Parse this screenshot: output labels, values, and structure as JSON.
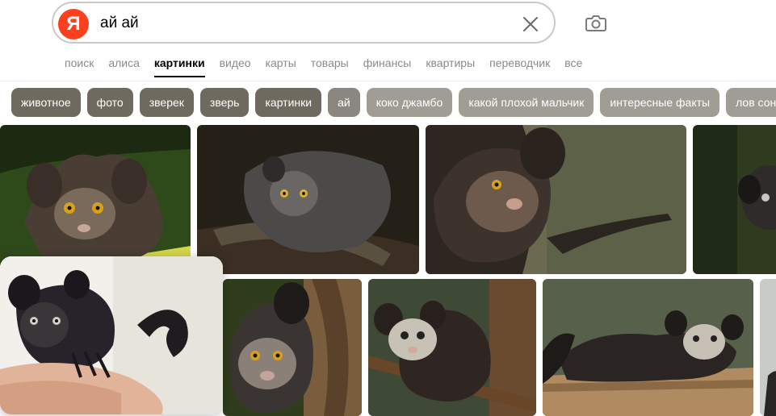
{
  "search": {
    "logo_letter": "Я",
    "query": "ай ай"
  },
  "nav": {
    "items": [
      {
        "label": "поиск"
      },
      {
        "label": "алиса"
      },
      {
        "label": "картинки",
        "active": true
      },
      {
        "label": "видео"
      },
      {
        "label": "карты"
      },
      {
        "label": "товары"
      },
      {
        "label": "финансы"
      },
      {
        "label": "квартиры"
      },
      {
        "label": "переводчик"
      },
      {
        "label": "все"
      }
    ]
  },
  "chips": [
    {
      "label": "животное"
    },
    {
      "label": "фото"
    },
    {
      "label": "зверек"
    },
    {
      "label": "зверь"
    },
    {
      "label": "картинки"
    },
    {
      "label": "ай"
    },
    {
      "label": "коко джамбо"
    },
    {
      "label": "какой плохой мальчик"
    },
    {
      "label": "интересные факты"
    },
    {
      "label": "лов сонг"
    }
  ],
  "colors": {
    "logo": "#fc3f1d",
    "chip_dark": "#6e6a60",
    "chip_light": "#a09d94",
    "nav_inactive": "#8a8a8a"
  },
  "icons": {
    "clear": "close-icon",
    "camera": "camera-search-icon"
  },
  "results": [
    {
      "name": "aye-aye-on-palm-leaf"
    },
    {
      "name": "aye-aye-on-branch-night"
    },
    {
      "name": "aye-aye-on-tree-trunk"
    },
    {
      "name": "aye-aye-partial-dark"
    },
    {
      "name": "aye-aye-baby-on-hand"
    },
    {
      "name": "aye-aye-close-up-tree"
    },
    {
      "name": "aye-aye-juvenile-branch"
    },
    {
      "name": "aye-aye-on-log"
    },
    {
      "name": "aye-aye-partial-right"
    }
  ]
}
